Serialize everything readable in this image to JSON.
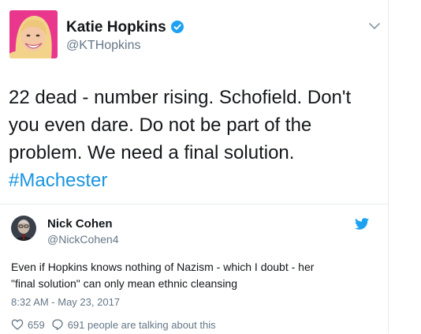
{
  "author": {
    "display_name": "Katie Hopkins",
    "handle": "@KTHopkins",
    "verified": true,
    "avatar_icon": "profile-photo"
  },
  "tweet": {
    "text_lines": [
      "22 dead - number rising. Schofield. Don't",
      "you even dare. Do not be part of the",
      "problem. We need a final solution."
    ],
    "hashtag": "#Machester"
  },
  "quoted_tweet": {
    "display_name": "Nick Cohen",
    "handle": "@NickCohen4",
    "text_lines": [
      "Even if Hopkins knows nothing of Nazism - which I doubt - her",
      "\"final solution\"  can only mean ethnic cleansing"
    ],
    "timestamp": "8:32 AM - May 23, 2017",
    "likes": "659",
    "talking": "691 people are talking about this"
  },
  "colors": {
    "link": "#1b95e0",
    "text": "#14171a",
    "muted": "#657786",
    "verified": "#1da1f2",
    "twitter_bird": "#1da1f2",
    "avatar_bg": "#e8378d"
  }
}
